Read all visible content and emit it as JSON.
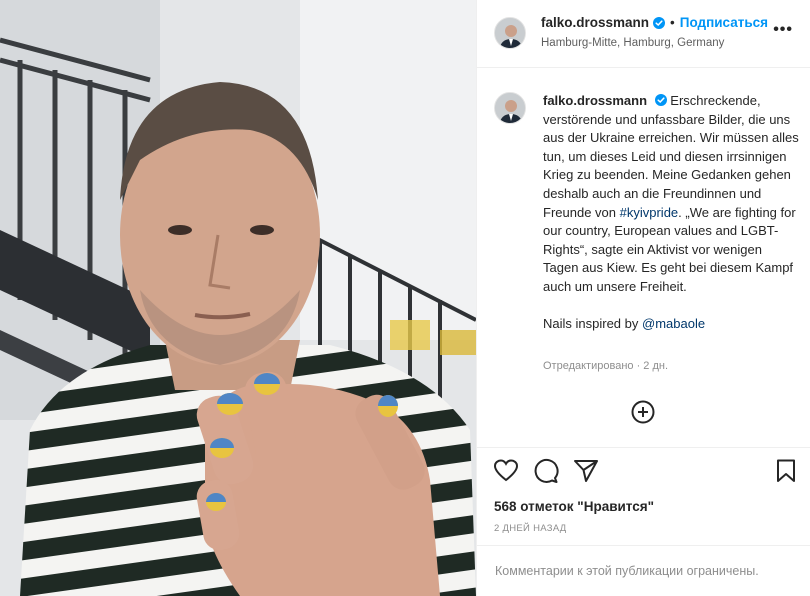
{
  "post": {
    "username": "falko.drossmann",
    "follow_label": "Подписаться",
    "separator": "•",
    "location": "Hamburg-Mitte, Hamburg, Germany",
    "more_label": "•••"
  },
  "caption": {
    "username": "falko.drossmann",
    "text_1": "Erschreckende, verstörende und unfassbare Bilder, die uns aus der Ukraine erreichen. Wir müssen alles tun, um dieses Leid und diesen irrsinnigen Krieg zu beenden. Meine Gedanken gehen deshalb auch an die Freundinnen und Freunde von",
    "hashtag": "#kyivpride",
    "text_2": ". „We are fighting for our country, European values and LGBT-Rights“, sagte ein Aktivist vor wenigen Tagen aus Kiew. Es geht bei diesem Kampf auch um unsere Freiheit.",
    "nails_text": "Nails inspired by",
    "mention": "@mabaole",
    "edited": "Отредактировано · 2 дн."
  },
  "stats": {
    "likes": "568 отметок \"Нравится\"",
    "date": "2 ДНЕЙ НАЗАД",
    "comments_closed": "Комментарии к этой публикации ограничены."
  },
  "icons": {
    "header_avatar": "profile-avatar",
    "verified": "verified-badge-icon",
    "add_comment": "plus-circle-icon",
    "like": "heart-icon",
    "comment": "comment-icon",
    "share": "send-icon",
    "save": "bookmark-icon"
  },
  "colors": {
    "link": "#0095f6",
    "hashtag": "#00376b",
    "muted": "#8e8e8e",
    "nail_blue": "#4f86c6",
    "nail_yellow": "#e8c440"
  }
}
